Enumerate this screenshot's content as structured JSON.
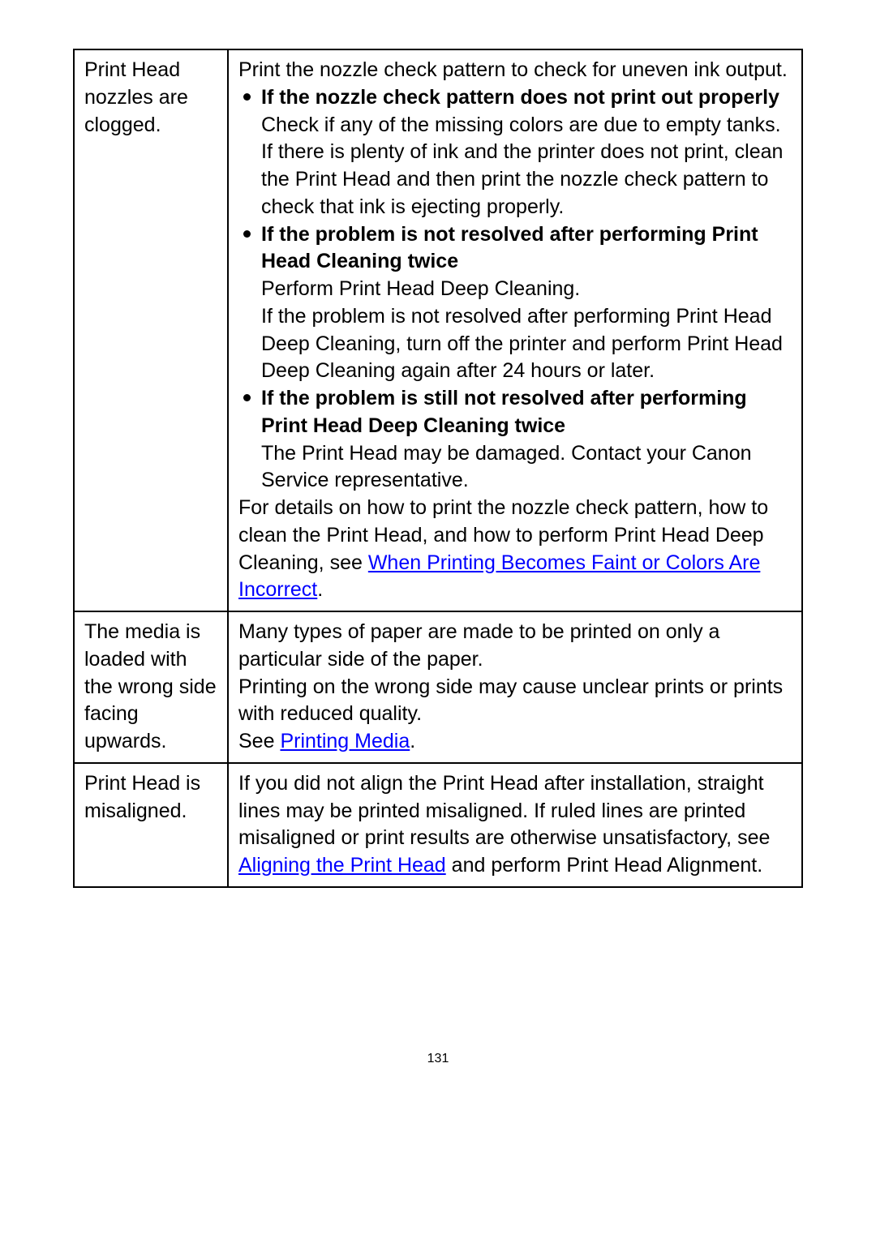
{
  "row1": {
    "cause": "Print Head nozzles are clogged.",
    "intro": "Print the nozzle check pattern to check for uneven ink output.",
    "b1_head": "If the nozzle check pattern does not print out properly",
    "b1_t1": "Check if any of the missing colors are due to empty tanks.",
    "b1_t2": "If there is plenty of ink and the printer does not print, clean the Print Head and then print the nozzle check pattern to check that ink is ejecting properly.",
    "b2_head": "If the problem is not resolved after performing Print Head Cleaning twice",
    "b2_t1": "Perform Print Head Deep Cleaning.",
    "b2_t2": "If the problem is not resolved after performing Print Head Deep Cleaning, turn off the printer and perform Print Head Deep Cleaning again after 24 hours or later.",
    "b3_head": "If the problem is still not resolved after performing Print Head Deep Cleaning twice",
    "b3_t1": "The Print Head may be damaged. Contact your Canon Service representative.",
    "outro_a": "For details on how to print the nozzle check pattern, how to clean the Print Head, and how to perform Print Head Deep Cleaning, see ",
    "outro_link": "When Printing Becomes Faint or Colors Are Incorrect",
    "outro_b": "."
  },
  "row2": {
    "cause": "The media is loaded with the wrong side facing upwards.",
    "t1": "Many types of paper are made to be printed on only a particular side of the paper.",
    "t2": "Printing on the wrong side may cause unclear prints or prints with reduced quality.",
    "see": "See ",
    "link": "Printing Media",
    "dot": "."
  },
  "row3": {
    "cause": "Print Head is misaligned.",
    "t1": "If you did not align the Print Head after installation, straight lines may be printed misaligned. If ruled lines are printed misaligned or print results are otherwise unsatisfactory, see ",
    "link": "Aligning the Print Head",
    "t2": " and perform Print Head Alignment."
  },
  "page": "131"
}
